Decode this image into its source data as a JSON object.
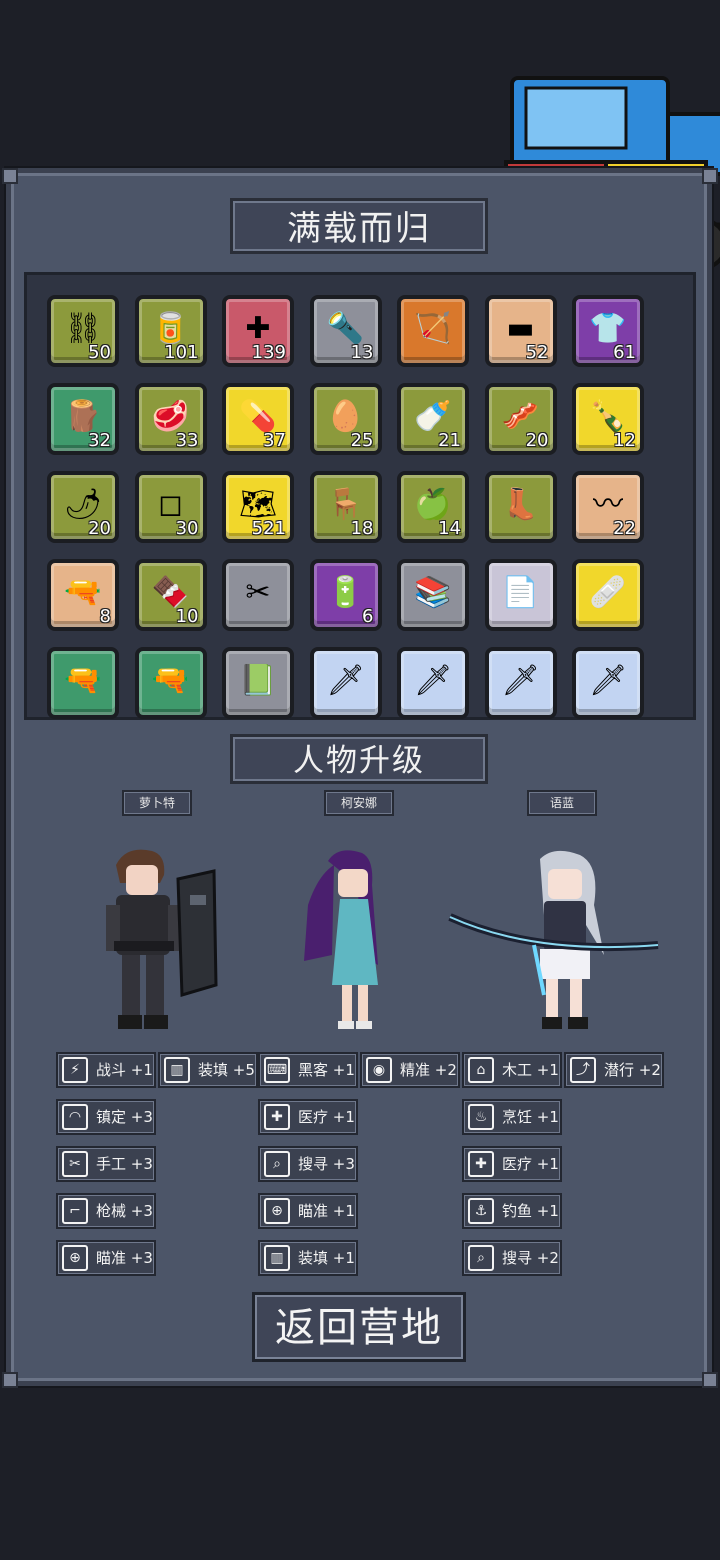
{
  "header": {
    "title": "满载而归"
  },
  "inventory": {
    "items": [
      {
        "icon": "handcuffs-icon",
        "glyph": "⛓",
        "count": "50",
        "color": "olive"
      },
      {
        "icon": "canned-food-icon",
        "glyph": "🥫",
        "count": "101",
        "color": "olive"
      },
      {
        "icon": "first-aid-icon",
        "glyph": "✚",
        "count": "139",
        "color": "red"
      },
      {
        "icon": "flashlight-icon",
        "glyph": "🔦",
        "count": "13",
        "color": "gray"
      },
      {
        "icon": "bow-icon",
        "glyph": "🏹",
        "count": "",
        "color": "orange"
      },
      {
        "icon": "soap-icon",
        "glyph": "▬",
        "count": "52",
        "color": "peach"
      },
      {
        "icon": "shirt-icon",
        "glyph": "👕",
        "count": "61",
        "color": "purple"
      },
      {
        "icon": "wood-log-icon",
        "glyph": "🪵",
        "count": "32",
        "color": "green"
      },
      {
        "icon": "raw-meat-icon",
        "glyph": "🥩",
        "count": "33",
        "color": "olive"
      },
      {
        "icon": "medicine-icon",
        "glyph": "💊",
        "count": "37",
        "color": "yellow"
      },
      {
        "icon": "egg-icon",
        "glyph": "🥚",
        "count": "25",
        "color": "olive"
      },
      {
        "icon": "milk-bottle-icon",
        "glyph": "🍼",
        "count": "21",
        "color": "olive"
      },
      {
        "icon": "canned-meat-icon",
        "glyph": "🥓",
        "count": "20",
        "color": "olive"
      },
      {
        "icon": "liquor-bottle-icon",
        "glyph": "🍾",
        "count": "12",
        "color": "yellow"
      },
      {
        "icon": "chili-pepper-icon",
        "glyph": "🌶",
        "count": "20",
        "color": "olive"
      },
      {
        "icon": "cloth-icon",
        "glyph": "◻",
        "count": "30",
        "color": "olive"
      },
      {
        "icon": "map-icon",
        "glyph": "🗺",
        "count": "521",
        "color": "yellow"
      },
      {
        "icon": "chair-icon",
        "glyph": "🪑",
        "count": "18",
        "color": "olive"
      },
      {
        "icon": "apple-icon",
        "glyph": "🍏",
        "count": "14",
        "color": "olive"
      },
      {
        "icon": "boots-icon",
        "glyph": "👢",
        "count": "",
        "color": "olive"
      },
      {
        "icon": "rope-icon",
        "glyph": "〰",
        "count": "22",
        "color": "peach"
      },
      {
        "icon": "futuristic-gun-icon",
        "glyph": "🔫",
        "count": "8",
        "color": "peach"
      },
      {
        "icon": "chocolate-icon",
        "glyph": "🍫",
        "count": "10",
        "color": "olive"
      },
      {
        "icon": "scissors-icon",
        "glyph": "✂",
        "count": "",
        "color": "gray"
      },
      {
        "icon": "battery-icon",
        "glyph": "🔋",
        "count": "6",
        "color": "purple"
      },
      {
        "icon": "books-icon",
        "glyph": "📚",
        "count": "",
        "color": "gray"
      },
      {
        "icon": "document-icon",
        "glyph": "📄",
        "count": "",
        "color": "lavender"
      },
      {
        "icon": "bandage-icon",
        "glyph": "🩹",
        "count": "",
        "color": "yellow"
      },
      {
        "icon": "assault-rifle-icon",
        "glyph": "🔫",
        "count": "",
        "color": "green"
      },
      {
        "icon": "assault-rifle-icon",
        "glyph": "🔫",
        "count": "",
        "color": "green"
      },
      {
        "icon": "green-book-icon",
        "glyph": "📗",
        "count": "",
        "color": "gray"
      },
      {
        "icon": "sword-icon",
        "glyph": "🗡",
        "count": "",
        "color": "lightblue"
      },
      {
        "icon": "sword-icon",
        "glyph": "🗡",
        "count": "",
        "color": "lightblue"
      },
      {
        "icon": "sword-icon",
        "glyph": "🗡",
        "count": "",
        "color": "lightblue"
      },
      {
        "icon": "sword-icon",
        "glyph": "🗡",
        "count": "",
        "color": "lightblue"
      }
    ]
  },
  "upgrade": {
    "title": "人物升级",
    "characters": [
      {
        "name": "萝卜特",
        "skills": [
          {
            "icon": "combat-icon",
            "glyph": "⚡",
            "label": "战斗 +1"
          },
          {
            "icon": "reload-icon",
            "glyph": "▥",
            "label": "装填 +5"
          },
          {
            "icon": "calm-icon",
            "glyph": "◠",
            "label": "镇定 +3"
          },
          {
            "icon": "craft-icon",
            "glyph": "✂",
            "label": "手工 +3"
          },
          {
            "icon": "firearms-icon",
            "glyph": "⌐",
            "label": "枪械 +3"
          },
          {
            "icon": "aim-icon",
            "glyph": "⊕",
            "label": "瞄准 +3"
          }
        ]
      },
      {
        "name": "柯安娜",
        "skills": [
          {
            "icon": "hacker-icon",
            "glyph": "⌨",
            "label": "黑客 +1"
          },
          {
            "icon": "precision-icon",
            "glyph": "◉",
            "label": "精准 +2"
          },
          {
            "icon": "medical-icon",
            "glyph": "✚",
            "label": "医疗 +1"
          },
          {
            "icon": "search-icon",
            "glyph": "⌕",
            "label": "搜寻 +3"
          },
          {
            "icon": "aim-icon",
            "glyph": "⊕",
            "label": "瞄准 +1"
          },
          {
            "icon": "reload-icon",
            "glyph": "▥",
            "label": "装填 +1"
          }
        ]
      },
      {
        "name": "语蓝",
        "skills": [
          {
            "icon": "carpentry-icon",
            "glyph": "⌂",
            "label": "木工 +1"
          },
          {
            "icon": "stealth-icon",
            "glyph": "⤴",
            "label": "潜行 +2"
          },
          {
            "icon": "cooking-icon",
            "glyph": "♨",
            "label": "烹饪 +1"
          },
          {
            "icon": "medical-icon",
            "glyph": "✚",
            "label": "医疗 +1"
          },
          {
            "icon": "fishing-icon",
            "glyph": "⚓",
            "label": "钓鱼 +1"
          },
          {
            "icon": "search-icon",
            "glyph": "⌕",
            "label": "搜寻 +2"
          }
        ]
      }
    ]
  },
  "footer": {
    "return_label": "返回营地"
  },
  "colors": {
    "olive": "#8c9a3c",
    "red": "#c9596a",
    "gray": "#8e909a",
    "orange": "#d9782c",
    "peach": "#e6b48a",
    "purple": "#7e3ea8",
    "green": "#3f9a6c",
    "yellow": "#f1d72b",
    "lightblue": "#c2d4f2",
    "lavender": "#c9c5d7"
  }
}
